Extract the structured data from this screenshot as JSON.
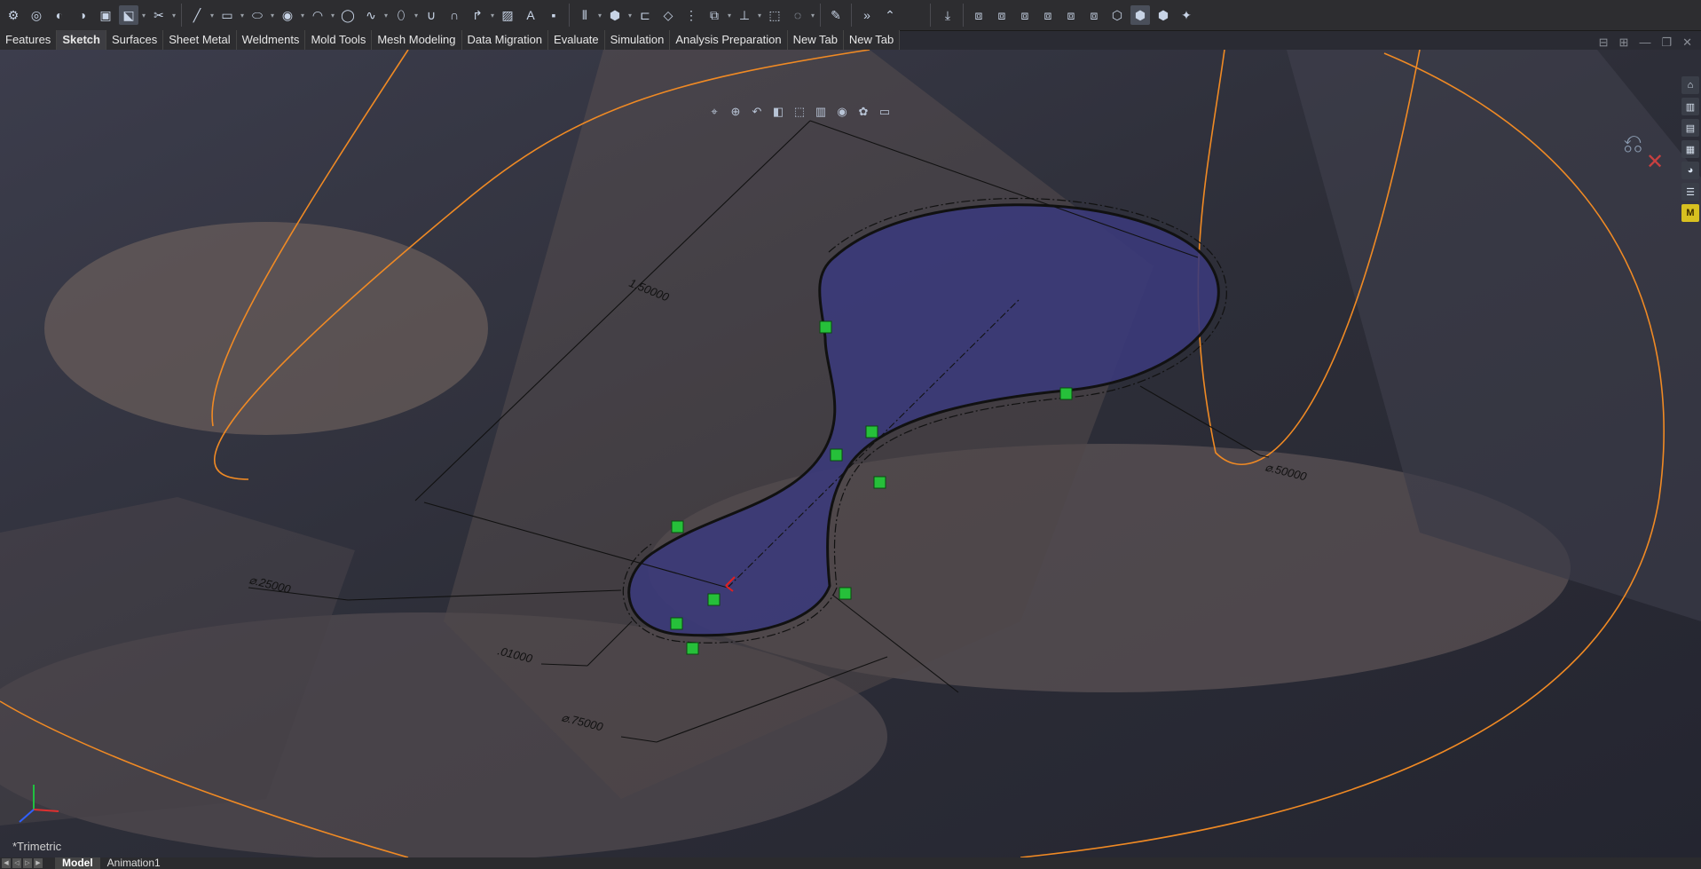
{
  "toolbar": {
    "icons": [
      "smart-dimension",
      "sketch",
      "line",
      "rectangle",
      "slot",
      "circle",
      "arc",
      "spline",
      "ellipse",
      "fillet",
      "offset",
      "text",
      "point",
      "mirror",
      "move",
      "pattern",
      "relations",
      "repair",
      "quick-snaps",
      "instant-2d",
      "view-orientation"
    ],
    "overflow_glyph": "»"
  },
  "tabs": [
    "Features",
    "Sketch",
    "Surfaces",
    "Sheet Metal",
    "Weldments",
    "Mold Tools",
    "Mesh Modeling",
    "Data Migration",
    "Evaluate",
    "Simulation",
    "Analysis Preparation",
    "New Tab",
    "New Tab"
  ],
  "active_tab": "Sketch",
  "dimensions": {
    "length": "1.50000",
    "dia_large": "⌀.50000",
    "dia_small": "⌀.25000",
    "offset": ".01000",
    "dia_mid": "⌀.75000"
  },
  "view_label": "*Trimetric",
  "bottom_tabs": [
    "Model",
    "Animation1"
  ],
  "colors": {
    "sketch_fill": "#3b3a7a",
    "orange_edge": "#f08a24",
    "background": "#2a2b33",
    "relation_green": "#26c03a"
  }
}
